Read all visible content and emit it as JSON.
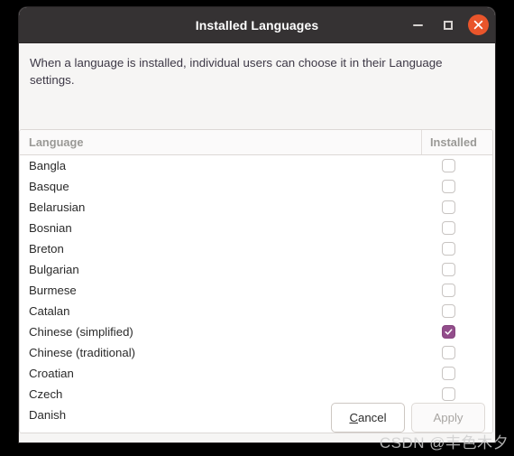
{
  "window": {
    "title": "Installed Languages",
    "controls": {
      "minimize_label": "minimize",
      "maximize_label": "maximize",
      "close_label": "close"
    },
    "accent_close_color": "#e9552b",
    "titlebar_color": "#353233"
  },
  "dialog": {
    "description": "When a language is installed, individual users can choose it in their Language settings."
  },
  "list": {
    "columns": {
      "language": "Language",
      "installed": "Installed"
    },
    "checked_color": "#924d8b",
    "rows": [
      {
        "language": "Bangla",
        "installed": false
      },
      {
        "language": "Basque",
        "installed": false
      },
      {
        "language": "Belarusian",
        "installed": false
      },
      {
        "language": "Bosnian",
        "installed": false
      },
      {
        "language": "Breton",
        "installed": false
      },
      {
        "language": "Bulgarian",
        "installed": false
      },
      {
        "language": "Burmese",
        "installed": false
      },
      {
        "language": "Catalan",
        "installed": false
      },
      {
        "language": "Chinese (simplified)",
        "installed": true
      },
      {
        "language": "Chinese (traditional)",
        "installed": false
      },
      {
        "language": "Croatian",
        "installed": false
      },
      {
        "language": "Czech",
        "installed": false
      },
      {
        "language": "Danish",
        "installed": false
      },
      {
        "language": "",
        "installed": false
      }
    ]
  },
  "footer": {
    "cancel_label": "Cancel",
    "cancel_mnemonic": "C",
    "cancel_rest": "ancel",
    "apply_label": "Apply",
    "apply_disabled": true
  },
  "watermark": {
    "text": "CSDN @丰色木夕"
  }
}
